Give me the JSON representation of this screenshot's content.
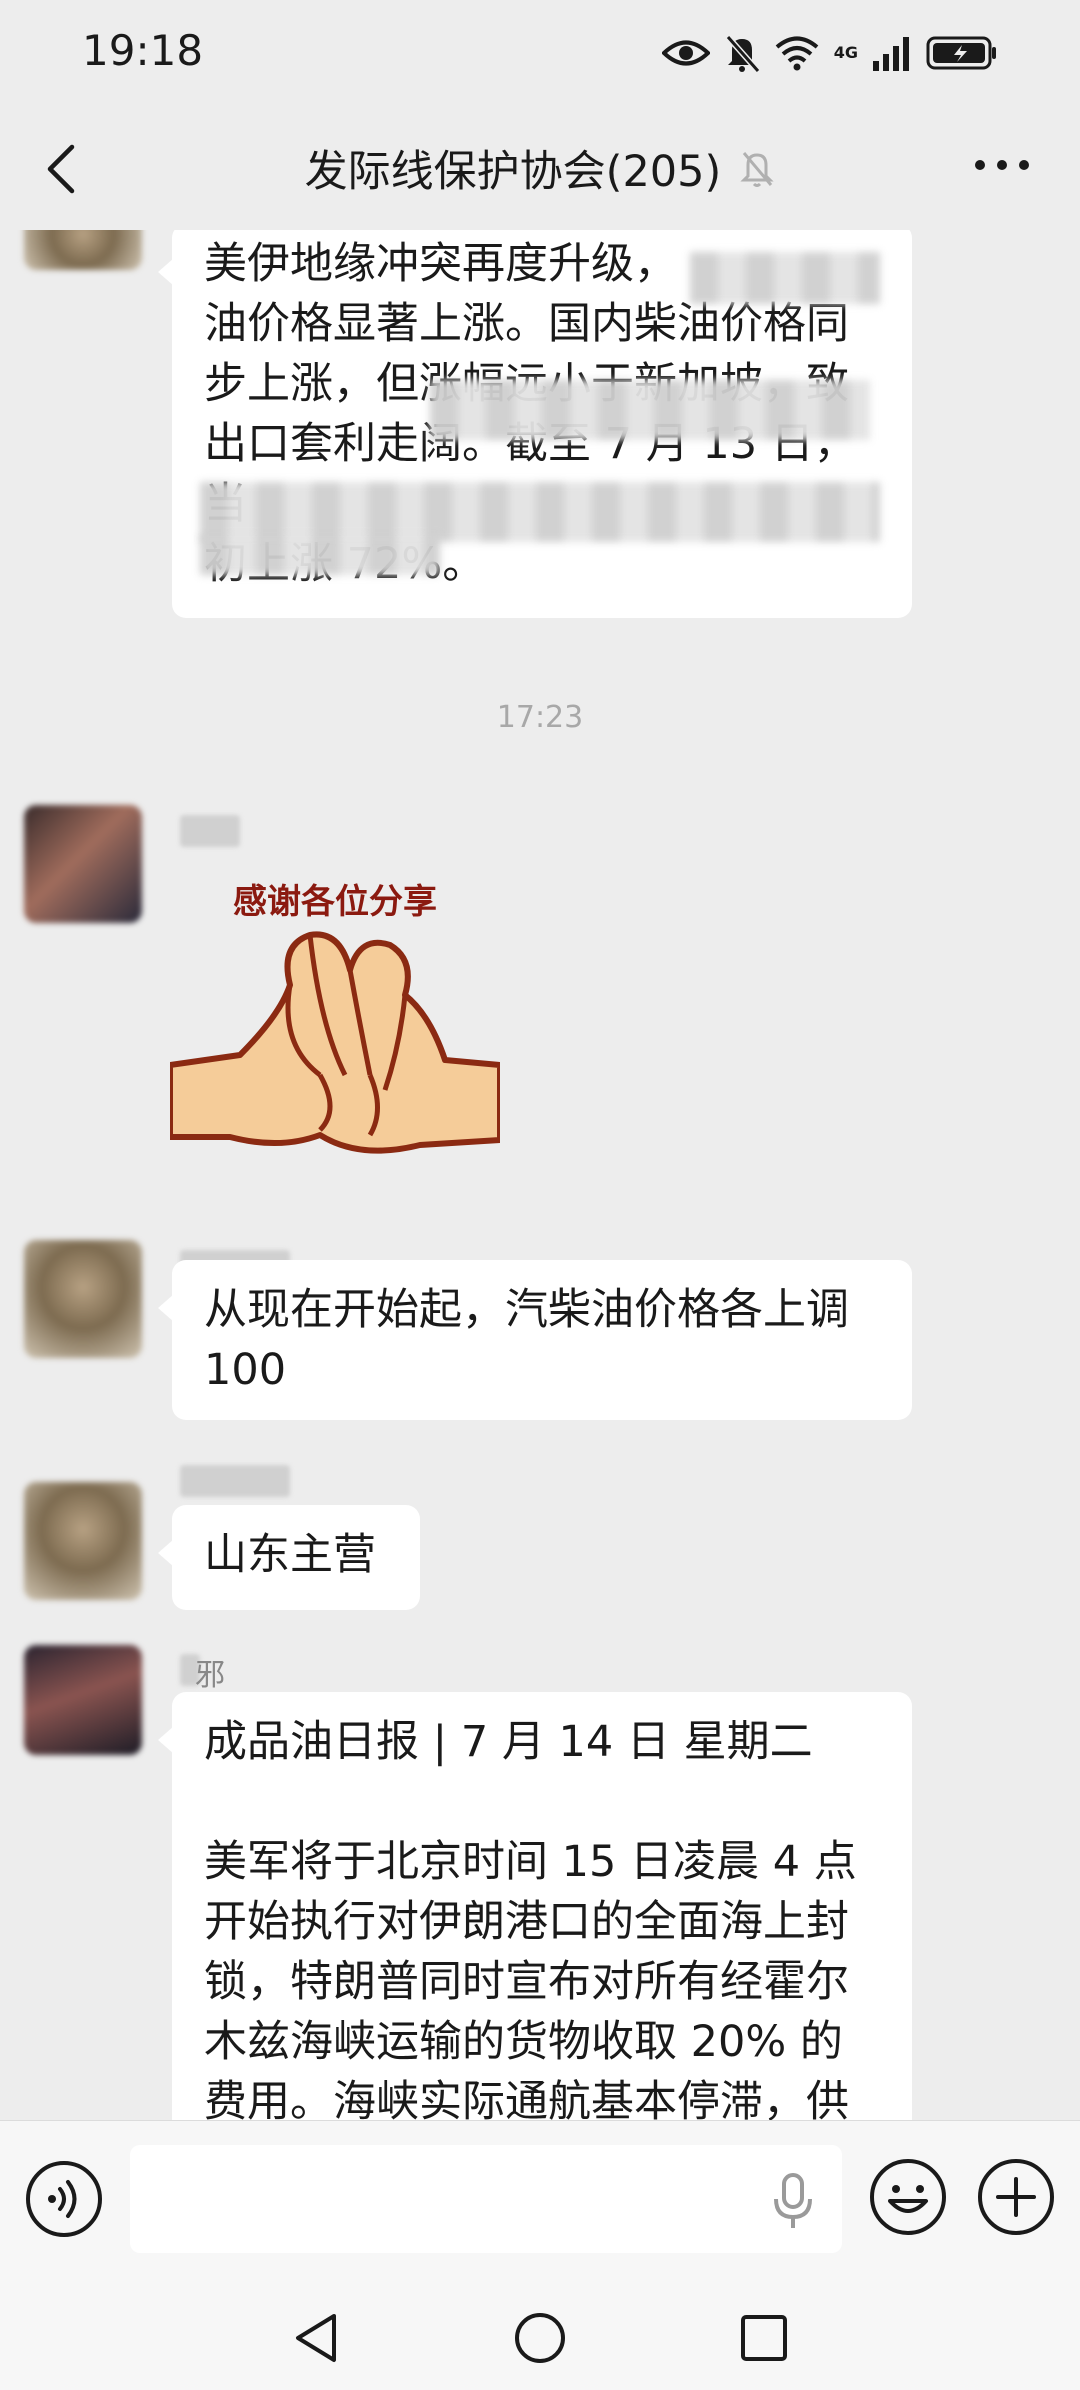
{
  "status_bar": {
    "time": "19:18",
    "network_label": "4G",
    "network_label_small": "6"
  },
  "header": {
    "title": "发际线保护协会(205)",
    "muted": true,
    "back_icon": "chevron-left-icon",
    "more_icon": "ellipsis-icon"
  },
  "messages": [
    {
      "type": "text",
      "lines": [
        "美伊地缘冲突再度升级，",
        "油价格显著上涨。国内柴油价格同",
        "步上涨，但涨幅远小于新加坡，致",
        "出口套利走阔。截至 7 月 13 日，",
        "当",
        "初上涨 72%。"
      ],
      "partially_redacted": true
    },
    {
      "type": "timestamp",
      "text": "17:23"
    },
    {
      "type": "sticker",
      "sticker_text": "感谢各位分享"
    },
    {
      "type": "text",
      "lines": [
        "从现在开始起，汽柴油价格各上调",
        "100"
      ]
    },
    {
      "type": "text",
      "lines": [
        "山东主营"
      ]
    },
    {
      "type": "text",
      "sender_partial": "邪",
      "lines": [
        "成品油日报 | 7 月 14 日 星期二",
        "",
        "美军将于北京时间 15 日凌晨 4 点",
        "开始执行对伊朗港口的全面海上封",
        "锁，特朗普同时宣布对所有经霍尔",
        "木兹海峡运输的货物收取 20% 的",
        "费用。海峡实际通航基本停滞，供"
      ]
    }
  ],
  "input_bar": {
    "placeholder": "",
    "voice_icon": "voice-icon",
    "mic_icon": "microphone-icon",
    "emoji_icon": "emoji-icon",
    "plus_icon": "plus-icon"
  },
  "system_nav": {
    "back_icon": "triangle-back-icon",
    "home_icon": "circle-home-icon",
    "recent_icon": "square-recents-icon"
  },
  "colors": {
    "background": "#ededed",
    "bubble": "#ffffff",
    "text": "#1a1a1a",
    "timestamp": "#a8a8a8"
  }
}
